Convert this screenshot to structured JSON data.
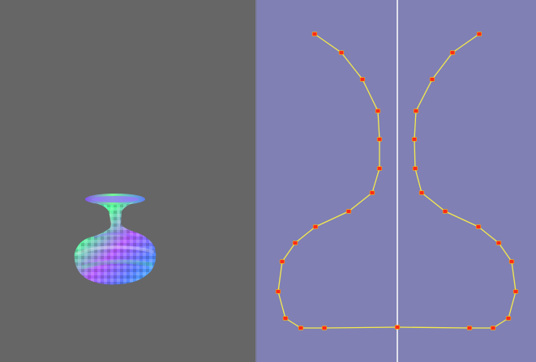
{
  "viewport": {
    "background": "#666666",
    "object": "vase"
  },
  "editor": {
    "background": "#8080b4",
    "axis_color": "#ffffff",
    "curve_color": "#f4e94c",
    "point_color": "#ff2a1a",
    "profile": {
      "left_points": [
        [
          71,
          42
        ],
        [
          104,
          65
        ],
        [
          130,
          98
        ],
        [
          149,
          137
        ],
        [
          151,
          172
        ],
        [
          151,
          208
        ],
        [
          142,
          238
        ],
        [
          113,
          261
        ],
        [
          72,
          280
        ],
        [
          47,
          300
        ],
        [
          31,
          323
        ],
        [
          26,
          360
        ],
        [
          35,
          393
        ],
        [
          54,
          405
        ],
        [
          83,
          405
        ],
        [
          173,
          404
        ]
      ],
      "right_points": [
        [
          274,
          42
        ],
        [
          241,
          65
        ],
        [
          216,
          98
        ],
        [
          196,
          137
        ],
        [
          194,
          172
        ],
        [
          195,
          208
        ],
        [
          203,
          238
        ],
        [
          232,
          261
        ],
        [
          273,
          280
        ],
        [
          298,
          300
        ],
        [
          314,
          323
        ],
        [
          319,
          360
        ],
        [
          310,
          393
        ],
        [
          291,
          405
        ],
        [
          262,
          405
        ],
        [
          173,
          404
        ]
      ]
    }
  }
}
